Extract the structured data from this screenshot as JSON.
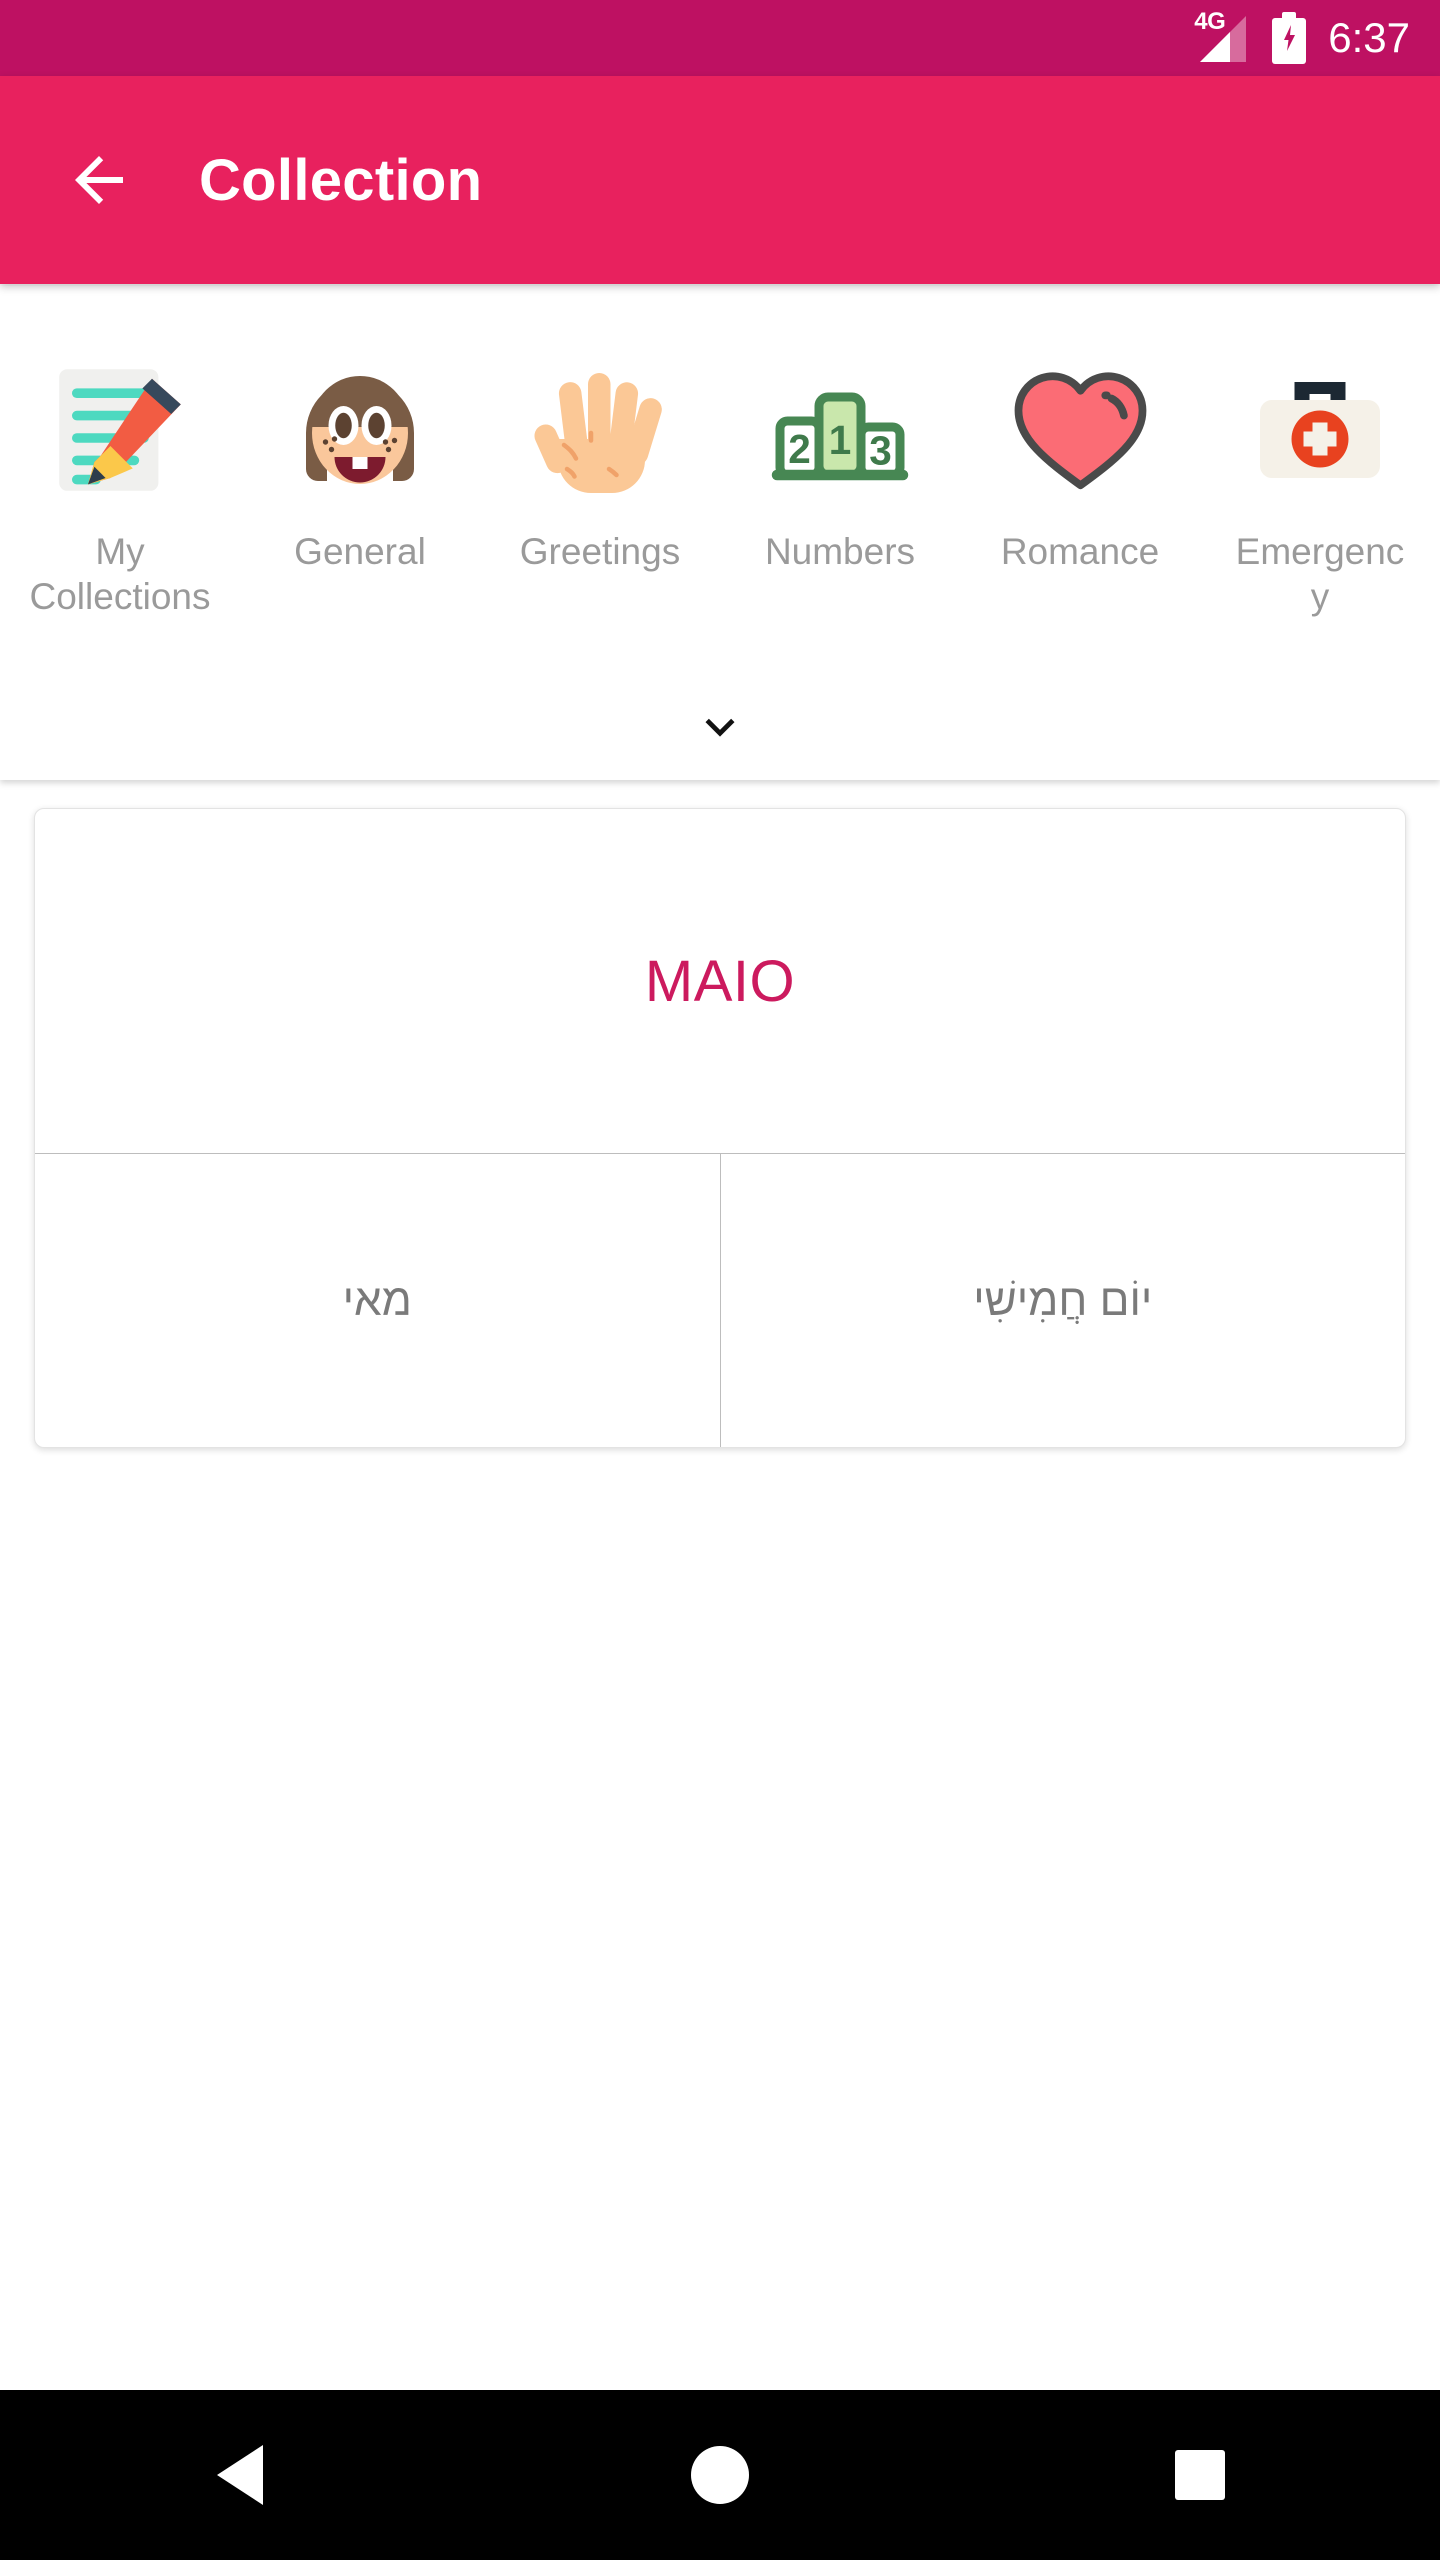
{
  "status_bar": {
    "network_label": "4G",
    "time": "6:37",
    "background_color": "#BE1162",
    "icons": [
      "signal-icon",
      "battery-charging-icon"
    ]
  },
  "app_bar": {
    "back_label": "back-arrow",
    "title": "Collection",
    "background_color": "#E8215E",
    "title_color": "#FFFFFF"
  },
  "categories": {
    "items": [
      {
        "label": "My Collections",
        "icon": "notepad-pencil-icon",
        "selected": true
      },
      {
        "label": "General",
        "icon": "girl-face-icon",
        "selected": false
      },
      {
        "label": "Greetings",
        "icon": "raised-hand-icon",
        "selected": false
      },
      {
        "label": "Numbers",
        "icon": "podium-123-icon",
        "selected": false
      },
      {
        "label": "Romance",
        "icon": "heart-icon",
        "selected": false
      },
      {
        "label": "Emergency",
        "icon": "first-aid-kit-icon",
        "selected": false
      }
    ],
    "expand_icon": "chevron-down-icon",
    "label_color": "#9A9A9A"
  },
  "card": {
    "word": "MAIO",
    "word_color": "#CC1A5E",
    "translation_left": "מאי",
    "translation_right": "יוֹם חֲמִישִׁי",
    "translation_color": "#7A7A7A"
  },
  "nav_bar": {
    "background_color": "#000000",
    "buttons": [
      {
        "name": "back",
        "icon": "triangle-back-icon"
      },
      {
        "name": "home",
        "icon": "circle-home-icon"
      },
      {
        "name": "recents",
        "icon": "square-recents-icon"
      }
    ]
  }
}
